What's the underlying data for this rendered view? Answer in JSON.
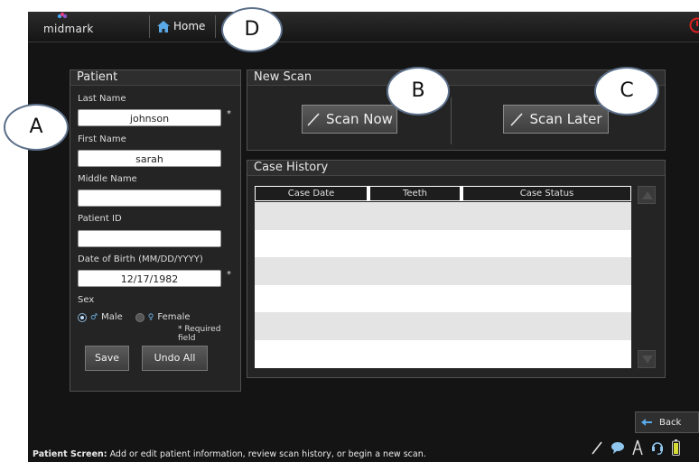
{
  "header": {
    "logo_text": "midmark",
    "home_label": "Home"
  },
  "patient_panel": {
    "title": "Patient",
    "last_name_label": "Last Name",
    "last_name_value": "johnson",
    "first_name_label": "First Name",
    "first_name_value": "sarah",
    "middle_name_label": "Middle Name",
    "middle_name_value": "",
    "patient_id_label": "Patient ID",
    "patient_id_value": "",
    "dob_label": "Date of Birth (MM/DD/YYYY)",
    "dob_value": "12/17/1982",
    "required_star": "*",
    "sex_label": "Sex",
    "sex_options": [
      "Male",
      "Female"
    ],
    "sex_selected": "Male",
    "required_note": "* Required field",
    "save_label": "Save",
    "undo_label": "Undo All"
  },
  "new_scan_panel": {
    "title": "New Scan",
    "scan_now_label": "Scan Now",
    "scan_later_label": "Scan Later"
  },
  "case_history_panel": {
    "title": "Case History",
    "columns": [
      "Case Date",
      "Teeth",
      "Case Status"
    ],
    "rows": []
  },
  "footer": {
    "back_label": "Back",
    "status_bold": "Patient Screen:",
    "status_text": " Add or edit patient information, review scan history, or begin a new scan."
  },
  "callouts": [
    "A",
    "B",
    "C",
    "D"
  ],
  "colors": {
    "background": "#141414",
    "panel": "#242424",
    "accent_blue": "#6fb4e8",
    "power_red": "#e02020"
  },
  "icons": [
    "home-icon",
    "power-icon",
    "scan-wand-icon",
    "back-arrow-icon",
    "wand-status-icon",
    "chat-icon",
    "signal-icon",
    "headset-icon",
    "battery-icon",
    "male-icon",
    "female-icon"
  ]
}
